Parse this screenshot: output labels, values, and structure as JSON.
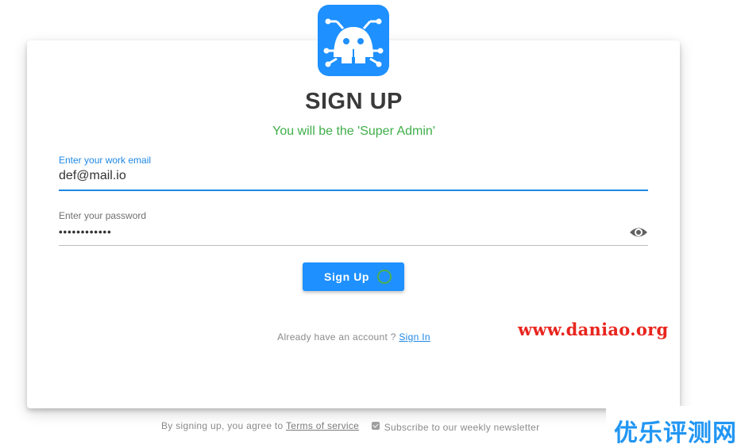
{
  "logo": {
    "icon": "robot-antenna-icon",
    "color": "#1e90ff"
  },
  "heading": {
    "title": "SIGN UP",
    "subtitle": "You will be the 'Super Admin'"
  },
  "form": {
    "email": {
      "label": "Enter your work email",
      "value": "def@mail.io"
    },
    "password": {
      "label": "Enter your password",
      "value": "••••••••••••",
      "toggle_icon": "eye-icon"
    },
    "submit": {
      "label": "Sign Up",
      "loading": true
    }
  },
  "signin_prompt": {
    "text": "Already have an account ? ",
    "link": "Sign In"
  },
  "footer": {
    "agree_text": "By signing up, you agree to ",
    "terms_link": "Terms of service",
    "newsletter_checked": true,
    "newsletter_label": "Subscribe to our weekly newsletter"
  },
  "watermarks": {
    "url": "www.daniao.org",
    "brand": "优乐评测网"
  },
  "colors": {
    "accent": "#1e88e5",
    "button": "#1e90ff",
    "subtitle": "#3fae49",
    "watermark_red": "#e8251e",
    "watermark_blue": "#2196f3"
  }
}
